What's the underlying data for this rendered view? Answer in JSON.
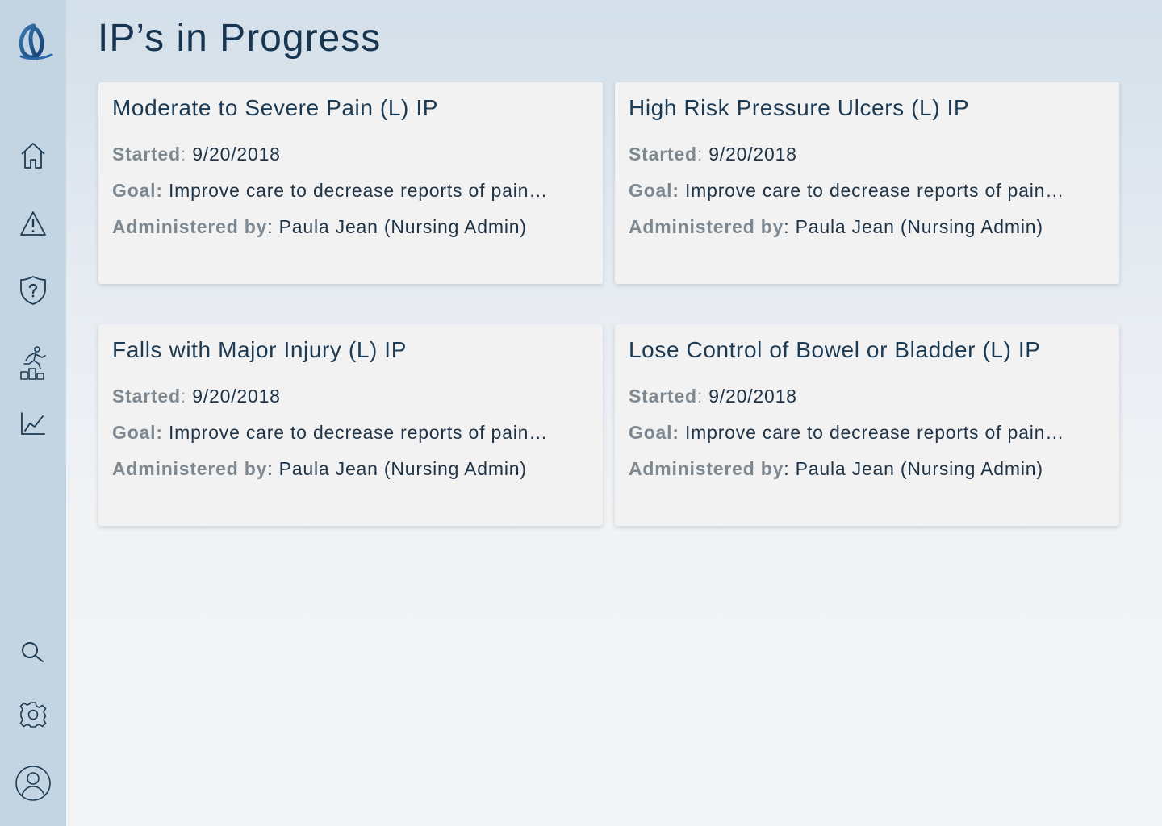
{
  "header": {
    "title": "IP’s in Progress"
  },
  "cards": [
    {
      "title": "Moderate to Severe Pain (L) IP",
      "started_label": "Started",
      "started_sep": ":",
      "started_value": "9/20/2018",
      "goal_label": "Goal:",
      "goal_value": "Improve care to decrease reports of pain…",
      "admin_label": "Administered by",
      "admin_sep": ":",
      "admin_value": "Paula Jean (Nursing Admin)"
    },
    {
      "title": "High Risk Pressure Ulcers (L) IP",
      "started_label": "Started",
      "started_sep": ":",
      "started_value": "9/20/2018",
      "goal_label": "Goal:",
      "goal_value": "Improve care to decrease reports of pain…",
      "admin_label": "Administered by",
      "admin_sep": ":",
      "admin_value": "Paula Jean (Nursing Admin)"
    },
    {
      "title": "Falls with Major Injury (L) IP",
      "started_label": "Started",
      "started_sep": ":",
      "started_value": "9/20/2018",
      "goal_label": "Goal:",
      "goal_value": "Improve care to decrease reports of pain…",
      "admin_label": "Administered by",
      "admin_sep": ":",
      "admin_value": "Paula Jean (Nursing Admin)"
    },
    {
      "title": "Lose Control of Bowel or Bladder (L) IP",
      "started_label": "Started",
      "started_sep": ":",
      "started_value": "9/20/2018",
      "goal_label": "Goal:",
      "goal_value": "Improve care to decrease reports of pain…",
      "admin_label": "Administered by",
      "admin_sep": ":",
      "admin_value": "Paula Jean (Nursing Admin)"
    }
  ],
  "sidebar": {
    "icons": [
      "logo-icon",
      "home-icon",
      "warning-icon",
      "shield-question-icon",
      "performance-icon",
      "line-chart-icon",
      "search-icon",
      "gear-icon",
      "user-avatar-icon"
    ]
  },
  "colors": {
    "sidebar_bg": "#c3d4e2",
    "card_bg": "#f2f2f2",
    "title_text": "#173551",
    "label_text": "#7d8890",
    "icon_stroke": "#1d3a52"
  }
}
